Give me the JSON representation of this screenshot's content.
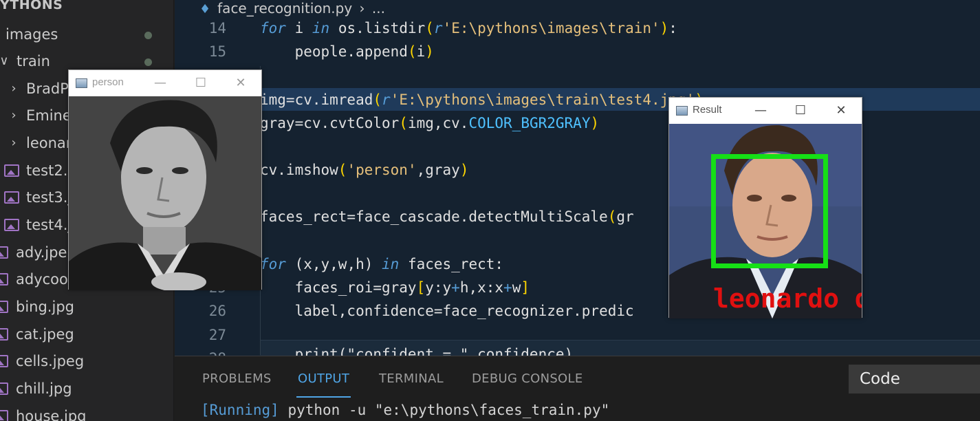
{
  "sidebar": {
    "title": "YTHONS",
    "items": [
      {
        "label": "images",
        "type": "folder-open",
        "indent": 0,
        "dot": true
      },
      {
        "label": "train",
        "type": "folder-open",
        "indent": 0,
        "dot": true,
        "chevron": "∨"
      },
      {
        "label": "BradP",
        "type": "folder",
        "chevron": "›"
      },
      {
        "label": "Emine",
        "type": "folder",
        "chevron": "›"
      },
      {
        "label": "leonar",
        "type": "folder",
        "chevron": "›"
      },
      {
        "label": "test2.p",
        "type": "image"
      },
      {
        "label": "test3.j",
        "type": "image"
      },
      {
        "label": "test4.j",
        "type": "image"
      },
      {
        "label": "ady.jpe",
        "type": "image"
      },
      {
        "label": "adycoo",
        "type": "image"
      },
      {
        "label": "bing.jpg",
        "type": "image"
      },
      {
        "label": "cat.jpeg",
        "type": "image"
      },
      {
        "label": "cells.jpeg",
        "type": "image"
      },
      {
        "label": "chill.jpg",
        "type": "image"
      },
      {
        "label": "house.jpg",
        "type": "image"
      }
    ]
  },
  "editor": {
    "breadcrumb_file": "face_recognition.py",
    "breadcrumb_sep": "›",
    "breadcrumb_more": "...",
    "line_numbers": [
      "14",
      "15",
      "",
      "",
      "",
      "",
      "",
      "",
      "",
      "25",
      "26",
      "27",
      "28"
    ],
    "code": {
      "l14_kw1": "for",
      "l14_a": " i ",
      "l14_kw2": "in",
      "l14_b": " os.listdir",
      "l14_p1": "(",
      "l14_r": "r",
      "l14_str": "'E:\\pythons\\images\\train'",
      "l14_p2": ")",
      "l14_c": ":",
      "l15_a": "    people.append",
      "l15_p1": "(",
      "l15_b": "i",
      "l15_p2": ")",
      "l17_a": "img=cv.imread",
      "l17_p1": "(",
      "l17_r": "r",
      "l17_str": "'E:\\pythons\\images\\train\\test4.jpg'",
      "l17_p2": ")",
      "l18_a": "gray=cv.cvtColor",
      "l18_p1": "(",
      "l18_b": "img,cv.",
      "l18_const": "COLOR_BGR2GRAY",
      "l18_p2": ")",
      "l20_a": "cv.imshow",
      "l20_p1": "(",
      "l20_str": "'person'",
      "l20_b": ",gray",
      "l20_p2": ")",
      "l22_a": "faces_rect=face_cascade.detectMultiScale",
      "l22_p1": "(",
      "l22_b": "gr",
      "l24_kw1": "for",
      "l24_a": " (x,y,w,h) ",
      "l24_kw2": "in",
      "l24_b": " faces_rect:",
      "l25_a": "    faces_roi=gray",
      "l25_p1": "[",
      "l25_b": "y:y",
      "l25_op1": "+",
      "l25_c": "h,x:x",
      "l25_op2": "+",
      "l25_d": "w",
      "l25_p2": "]",
      "l26_a": "    label,confidence=face_recognizer.predic",
      "l28_a": "    print(\"confident = \",confidence)"
    }
  },
  "windows": {
    "person": {
      "title": "person",
      "min": "—",
      "max": "☐",
      "close": "✕"
    },
    "result": {
      "title": "Result",
      "min": "—",
      "max": "☐",
      "close": "✕",
      "label": "leonardo d"
    }
  },
  "panel": {
    "tabs": [
      "PROBLEMS",
      "OUTPUT",
      "TERMINAL",
      "DEBUG CONSOLE"
    ],
    "active_tab": "OUTPUT",
    "output_tag": "[Running]",
    "output_cmd": " python -u \"e:\\pythons\\faces_train.py\""
  },
  "tooltip": {
    "label": "Code"
  },
  "colors": {
    "keyword": "#569cd6",
    "string": "#e6c07b",
    "bracket": "#ffd700",
    "constant": "#4fc1ff",
    "face_box": "#16e016",
    "label_red": "#e01010",
    "active_tab": "#4fa5e6"
  }
}
